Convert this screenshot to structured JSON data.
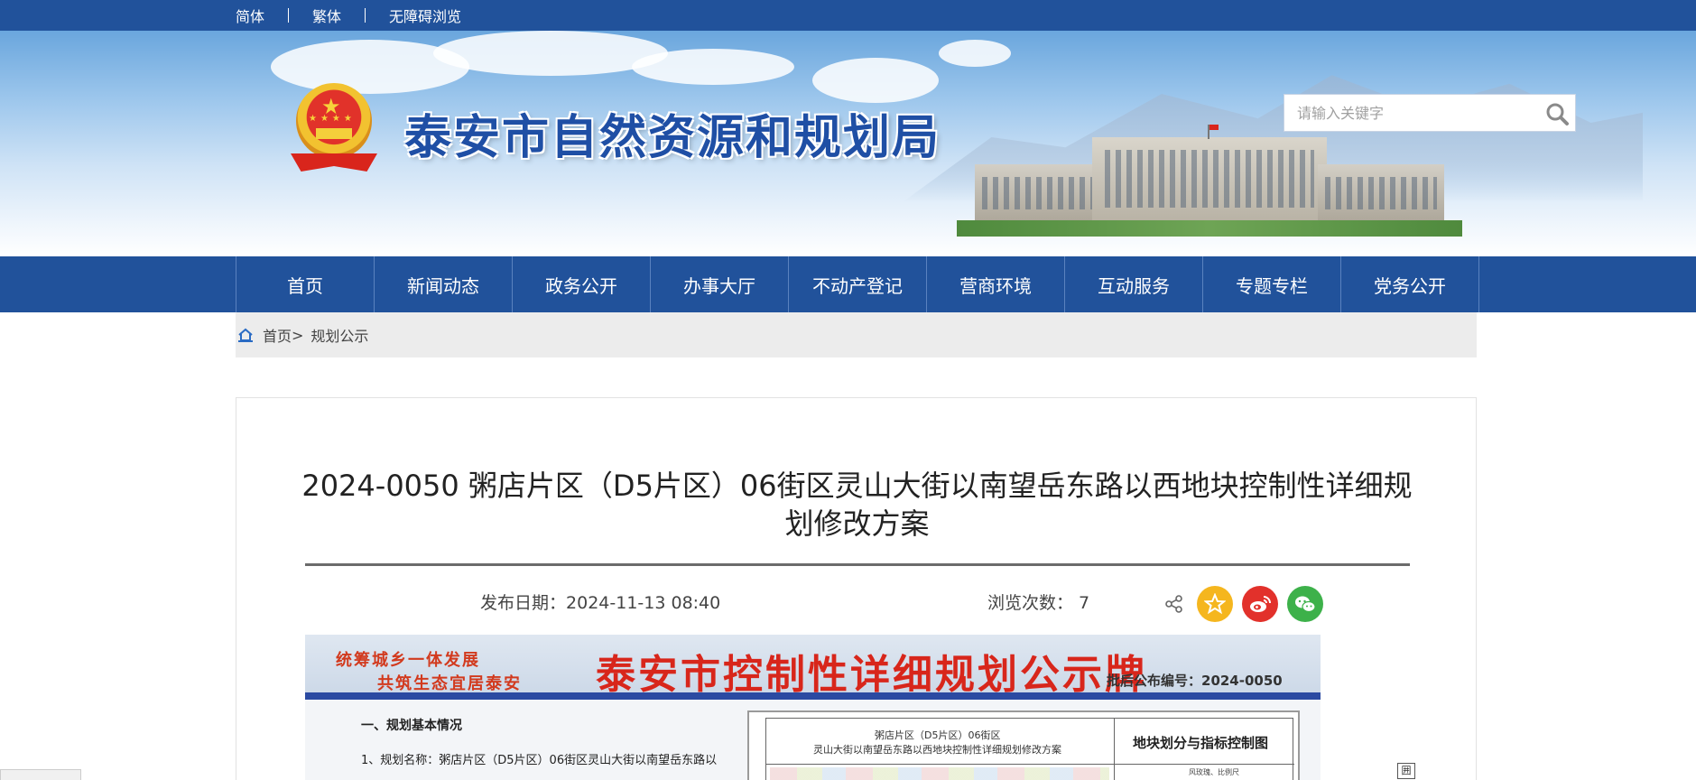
{
  "topbar": {
    "links": [
      "简体",
      "繁体",
      "无障碍浏览"
    ]
  },
  "header": {
    "site_title": "泰安市自然资源和规划局",
    "search_placeholder": "请输入关键字"
  },
  "nav": {
    "items": [
      "首页",
      "新闻动态",
      "政务公开",
      "办事大厅",
      "不动产登记",
      "营商环境",
      "互动服务",
      "专题专栏",
      "党务公开"
    ]
  },
  "breadcrumb": {
    "home": "首页",
    "separator": ">",
    "current": "规划公示"
  },
  "article": {
    "title": "2024-0050 粥店片区（D5片区）06街区灵山大街以南望岳东路以西地块控制性详细规划修改方案",
    "date_label": "发布日期：",
    "date_value": "2024-11-13 08:40",
    "views_label": "浏览次数：",
    "views_value": "7"
  },
  "share": {
    "icons": [
      "share-icon",
      "favorite-icon",
      "weibo-icon",
      "wechat-icon"
    ]
  },
  "notice_board": {
    "slogan_line1": "统筹城乡一体发展",
    "slogan_line2": "共筑生态宜居泰安",
    "title": "泰安市控制性详细规划公示牌",
    "code": "批后公布编号：2024-0050",
    "section_heading": "一、规划基本情况",
    "item_1": "1、规划名称：粥店片区（D5片区）06街区灵山大街以南望岳东路以",
    "map_title_line1": "粥店片区（D5片区）06街区",
    "map_title_line2": "灵山大街以南望岳东路以西地块控制性详细规划修改方案",
    "map_legend_title": "地块划分与指标控制图",
    "map_small_text": "风玫瑰、比例尺"
  },
  "colors": {
    "primary_blue": "#21529b",
    "title_red": "#d8261b",
    "favorite_yellow": "#f5b61e",
    "weibo_red": "#e2312b",
    "wechat_green": "#3db14a"
  }
}
